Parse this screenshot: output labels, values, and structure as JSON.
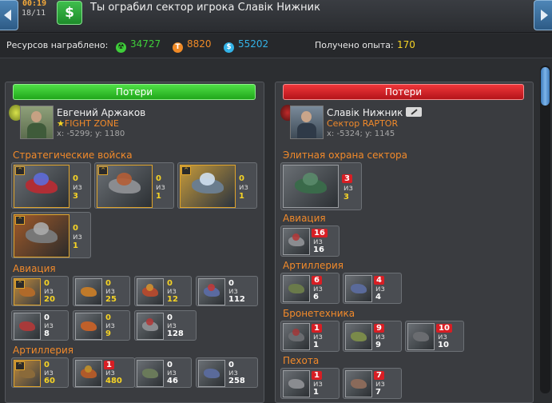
{
  "header": {
    "time": "00:19",
    "counter": "18/11",
    "title": "Ты ограбил сектор игрока Славік Нижник"
  },
  "resources": {
    "label": "Ресурсов награблено:",
    "items": [
      {
        "icon": "radiation-icon",
        "value": "34727",
        "color": "#3fce3a"
      },
      {
        "icon": "titanium-icon",
        "value": "8820",
        "color": "#f08a26"
      },
      {
        "icon": "credits-icon",
        "value": "55202",
        "color": "#33b3e8"
      }
    ],
    "xp_label": "Получено опыта:",
    "xp_value": "170"
  },
  "left": {
    "header": "Потери",
    "name": "Евгений Аржаков",
    "clan": "FIGHT ZONE",
    "coords": "x: -5299; y: 1180",
    "sections": [
      {
        "title": "Стратегические войска",
        "units": [
          {
            "lost": "0",
            "of": "из",
            "total": "3"
          },
          {
            "lost": "0",
            "of": "из",
            "total": "1"
          },
          {
            "lost": "0",
            "of": "из",
            "total": "1"
          },
          {
            "lost": "0",
            "of": "из",
            "total": "1"
          }
        ]
      },
      {
        "title": "Авиация",
        "units": [
          {
            "lost": "0",
            "of": "из",
            "total": "20"
          },
          {
            "lost": "0",
            "of": "из",
            "total": "25"
          },
          {
            "lost": "0",
            "of": "из",
            "total": "12"
          },
          {
            "lost": "0",
            "of": "из",
            "total": "112"
          },
          {
            "lost": "0",
            "of": "из",
            "total": "8"
          },
          {
            "lost": "0",
            "of": "из",
            "total": "9"
          },
          {
            "lost": "0",
            "of": "из",
            "total": "128"
          }
        ]
      },
      {
        "title": "Артиллерия",
        "units": [
          {
            "lost": "0",
            "of": "из",
            "total": "60"
          },
          {
            "lost": "1",
            "of": "из",
            "total": "480"
          },
          {
            "lost": "0",
            "of": "из",
            "total": "46"
          },
          {
            "lost": "0",
            "of": "из",
            "total": "258"
          }
        ]
      }
    ]
  },
  "right": {
    "header": "Потери",
    "name": "Славік Нижник",
    "clan": "Сектор RAPTOR",
    "coords": "x: -5324; y: 1145",
    "sections": [
      {
        "title": "Элитная охрана сектора",
        "units": [
          {
            "lost": "3",
            "of": "из",
            "total": "3"
          }
        ]
      },
      {
        "title": "Авиация",
        "units": [
          {
            "lost": "16",
            "of": "из",
            "total": "16"
          }
        ]
      },
      {
        "title": "Артиллерия",
        "units": [
          {
            "lost": "6",
            "of": "из",
            "total": "6"
          },
          {
            "lost": "4",
            "of": "из",
            "total": "4"
          }
        ]
      },
      {
        "title": "Бронетехника",
        "units": [
          {
            "lost": "1",
            "of": "из",
            "total": "1"
          },
          {
            "lost": "9",
            "of": "из",
            "total": "9"
          },
          {
            "lost": "10",
            "of": "из",
            "total": "10"
          }
        ]
      },
      {
        "title": "Пехота",
        "units": [
          {
            "lost": "1",
            "of": "из",
            "total": "1"
          },
          {
            "lost": "7",
            "of": "из",
            "total": "7"
          }
        ]
      }
    ]
  }
}
